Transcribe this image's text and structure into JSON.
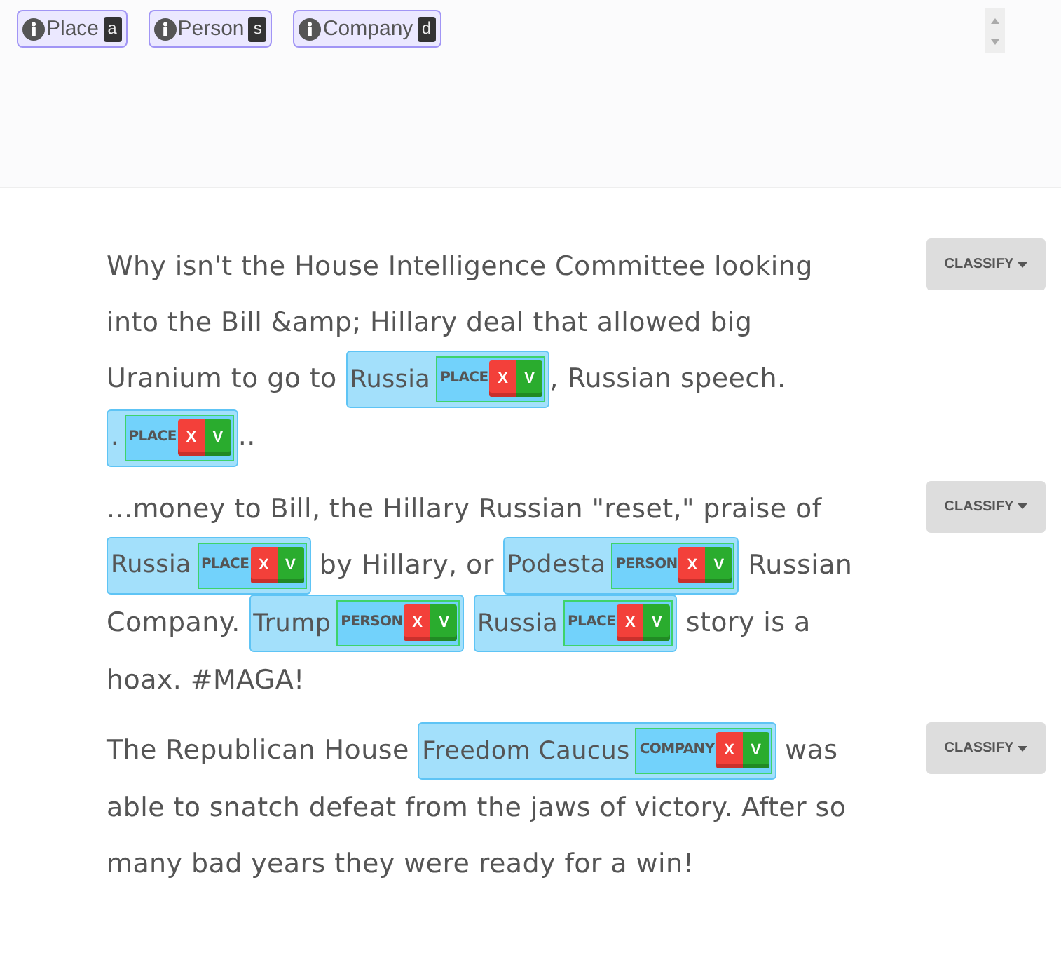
{
  "label_buttons": [
    {
      "name": "Place",
      "key": "a"
    },
    {
      "name": "Person",
      "key": "s"
    },
    {
      "name": "Company",
      "key": "d"
    }
  ],
  "items": [
    {
      "classify": "CLASSIFY",
      "segments": [
        {
          "kind": "text",
          "text": "Why isn't the House Intelligence Committee looking into the Bill &amp; Hillary deal that allowed big Uranium to go to "
        },
        {
          "kind": "entity",
          "text": "Russia",
          "label": "PLACE",
          "reject": "X",
          "accept": "V"
        },
        {
          "kind": "text",
          "text": ", Russian speech. "
        },
        {
          "kind": "entity",
          "text": ".",
          "label": "PLACE",
          "reject": "X",
          "accept": "V"
        },
        {
          "kind": "text",
          "text": ".."
        }
      ]
    },
    {
      "classify": "CLASSIFY",
      "segments": [
        {
          "kind": "text",
          "text": "...money to Bill, the Hillary Russian \"reset,\" praise of "
        },
        {
          "kind": "entity",
          "text": "Russia",
          "label": "PLACE",
          "reject": "X",
          "accept": "V"
        },
        {
          "kind": "text",
          "text": " by Hillary, or "
        },
        {
          "kind": "entity",
          "text": "Podesta",
          "label": "PERSON",
          "reject": "X",
          "accept": "V"
        },
        {
          "kind": "text",
          "text": " Russian Company. "
        },
        {
          "kind": "entity",
          "text": "Trump",
          "label": "PERSON",
          "reject": "X",
          "accept": "V"
        },
        {
          "kind": "space"
        },
        {
          "kind": "entity",
          "text": "Russia",
          "label": "PLACE",
          "reject": "X",
          "accept": "V"
        },
        {
          "kind": "text",
          "text": " story is a hoax. #MAGA!"
        }
      ]
    },
    {
      "classify": "CLASSIFY",
      "segments": [
        {
          "kind": "text",
          "text": "The Republican House "
        },
        {
          "kind": "entity",
          "text": "Freedom Caucus",
          "label": "COMPANY",
          "reject": "X",
          "accept": "V"
        },
        {
          "kind": "text",
          "text": " was able to snatch defeat from the jaws of victory. After so many bad years they were ready for a win!"
        }
      ]
    }
  ]
}
